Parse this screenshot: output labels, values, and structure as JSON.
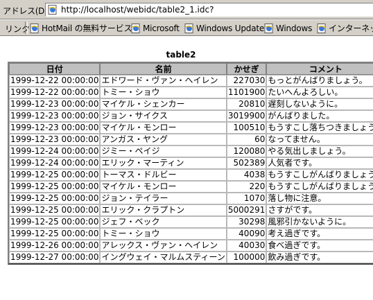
{
  "address_bar": {
    "label": "アドレス(D)",
    "url": "http://localhost/webidc/table2_1.idc?"
  },
  "links_bar": {
    "label": "リンク",
    "items": [
      {
        "label": "HotMail の無料サービス",
        "icon": "ie-page-icon"
      },
      {
        "label": "Microsoft",
        "icon": "ie-page-icon"
      },
      {
        "label": "Windows Update",
        "icon": "ie-page-icon"
      },
      {
        "label": "Windows",
        "icon": "ie-page-icon"
      },
      {
        "label": "インターネットの",
        "icon": "ie-page-icon"
      }
    ]
  },
  "table": {
    "title": "table2",
    "headers": [
      "日付",
      "名前",
      "かせぎ",
      "コメント"
    ],
    "rows": [
      [
        "1999-12-22 00:00:00",
        "エドワード・ヴァン・ヘイレン",
        "227030",
        "もっとがんばりましょう。"
      ],
      [
        "1999-12-22 00:00:00",
        "トミー・ショウ",
        "1101900",
        "たいへんよろしい。"
      ],
      [
        "1999-12-23 00:00:00",
        "マイケル・シェンカー",
        "20810",
        "遅刻しないように。"
      ],
      [
        "1999-12-23 00:00:00",
        "ジョン・サイクス",
        "3019900",
        "がんばりました。"
      ],
      [
        "1999-12-23 00:00:00",
        "マイケル・モンロー",
        "100510",
        "もうすこし落ちつきましょう。"
      ],
      [
        "1999-12-23 00:00:00",
        "アンガス・ヤング",
        "60",
        "なってません。"
      ],
      [
        "1999-12-24 00:00:00",
        "ジミー・ペイジ",
        "120080",
        "やる気出しましょう。"
      ],
      [
        "1999-12-24 00:00:00",
        "エリック・マーティン",
        "502389",
        "人気者です。"
      ],
      [
        "1999-12-25 00:00:00",
        "トーマス・ドルビー",
        "4038",
        "もうすこしがんばりましょう。"
      ],
      [
        "1999-12-25 00:00:00",
        "マイケル・モンロー",
        "220",
        "もうすこしがんばりましょう。"
      ],
      [
        "1999-12-25 00:00:00",
        "ジョン・テイラー",
        "1070",
        "落し物に注意。"
      ],
      [
        "1999-12-25 00:00:00",
        "エリック・クラプトン",
        "5000291",
        "さすがです。"
      ],
      [
        "1999-12-25 00:00:00",
        "ジェフ・ベック",
        "30298",
        "風邪引かないように。"
      ],
      [
        "1999-12-25 00:00:00",
        "トミー・ショウ",
        "40090",
        "考え過ぎです。"
      ],
      [
        "1999-12-26 00:00:00",
        "アレックス・ヴァン・ヘイレン",
        "40030",
        "食べ過ぎです。"
      ],
      [
        "1999-12-27 00:00:00",
        "イングウェイ・マルムスティーン",
        "100000",
        "飲み過ぎです。"
      ]
    ]
  }
}
